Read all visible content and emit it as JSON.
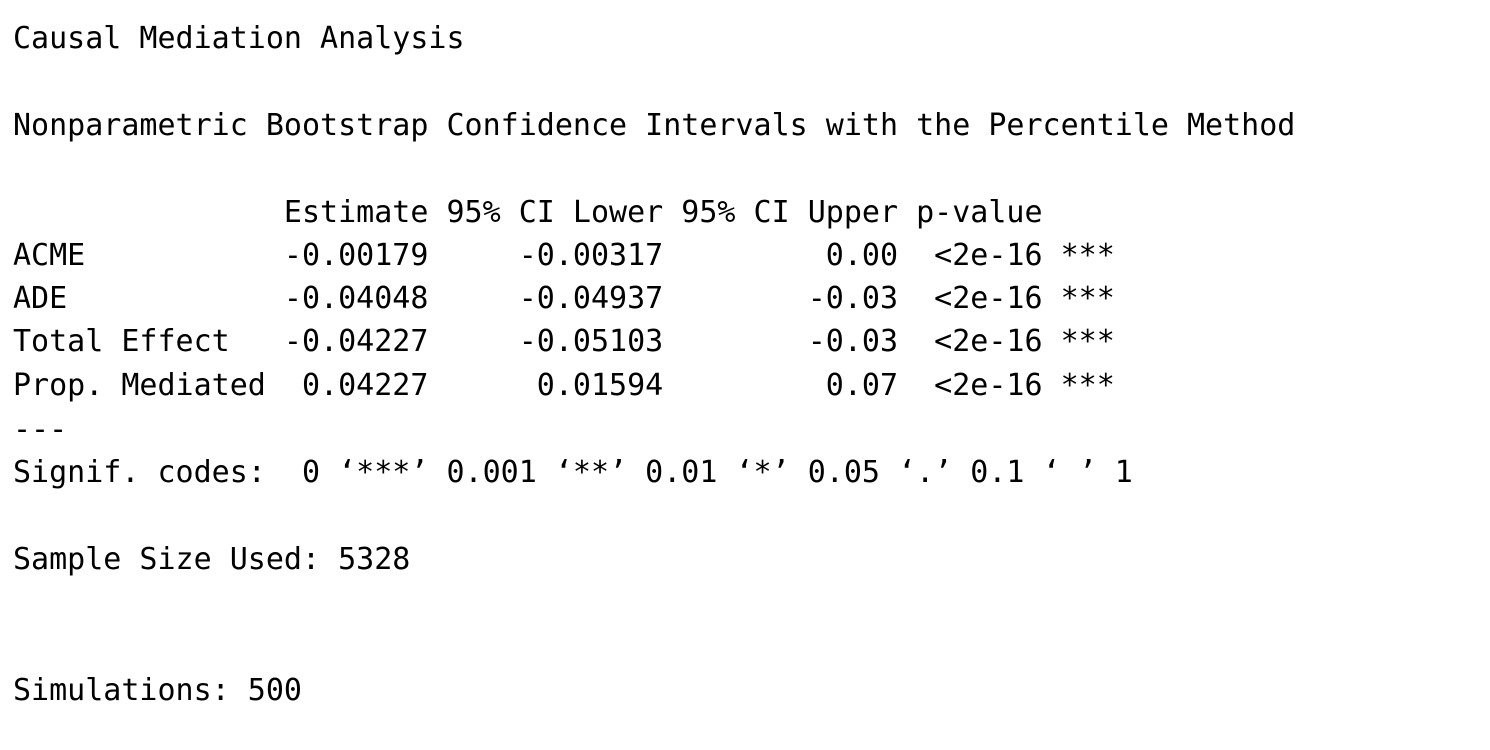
{
  "title": "Causal Mediation Analysis",
  "subtitle": "Nonparametric Bootstrap Confidence Intervals with the Percentile Method",
  "table": {
    "header": "               Estimate 95% CI Lower 95% CI Upper p-value    ",
    "columns": [
      "Estimate",
      "95% CI Lower",
      "95% CI Upper",
      "p-value"
    ],
    "rows": [
      {
        "label": "ACME",
        "estimate": "-0.00179",
        "ci_lower": "-0.00317",
        "ci_upper": "0.00",
        "p_value": "<2e-16",
        "signif": "***",
        "text": "ACME           -0.00179     -0.00317         0.00  <2e-16 ***"
      },
      {
        "label": "ADE",
        "estimate": "-0.04048",
        "ci_lower": "-0.04937",
        "ci_upper": "-0.03",
        "p_value": "<2e-16",
        "signif": "***",
        "text": "ADE            -0.04048     -0.04937        -0.03  <2e-16 ***"
      },
      {
        "label": "Total Effect",
        "estimate": "-0.04227",
        "ci_lower": "-0.05103",
        "ci_upper": "-0.03",
        "p_value": "<2e-16",
        "signif": "***",
        "text": "Total Effect   -0.04227     -0.05103        -0.03  <2e-16 ***"
      },
      {
        "label": "Prop. Mediated",
        "estimate": "0.04227",
        "ci_lower": "0.01594",
        "ci_upper": "0.07",
        "p_value": "<2e-16",
        "signif": "***",
        "text": "Prop. Mediated  0.04227      0.01594         0.07  <2e-16 ***"
      }
    ]
  },
  "separator": "---",
  "signif_codes": "Signif. codes:  0 ‘***’ 0.001 ‘**’ 0.01 ‘*’ 0.05 ‘.’ 0.1 ‘ ’ 1",
  "sample_size": "Sample Size Used: 5328",
  "simulations": "Simulations: 500"
}
